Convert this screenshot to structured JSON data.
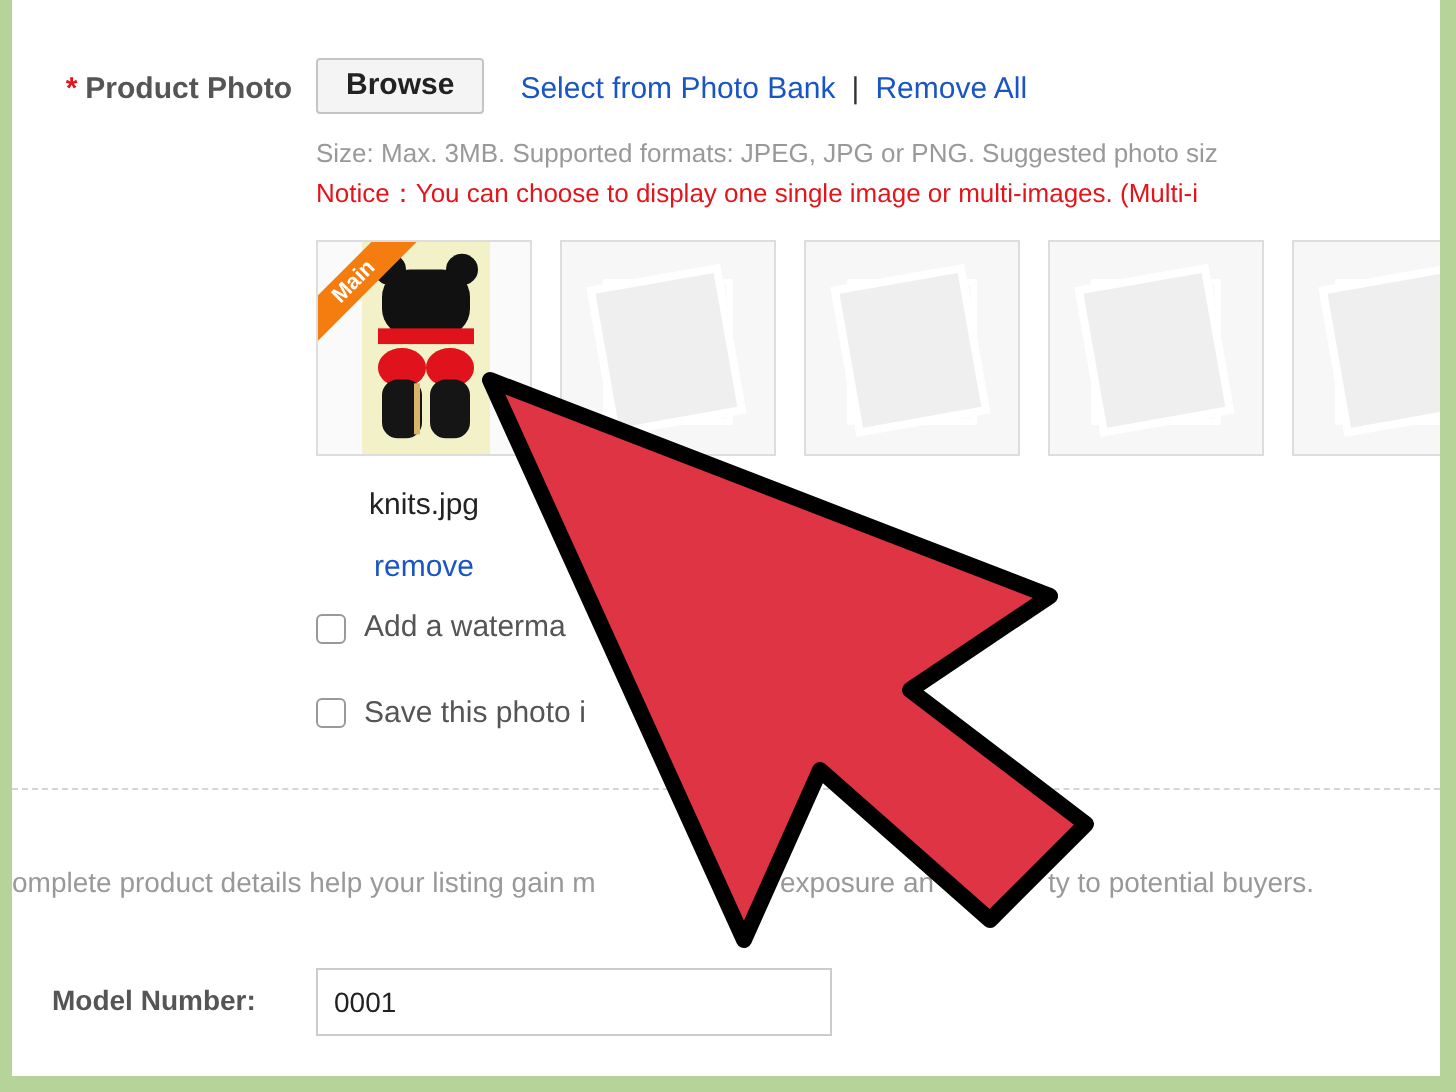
{
  "product_photo": {
    "required_mark": "*",
    "label": "Product Photo",
    "browse_button": "Browse",
    "links": [
      "Select from Photo Bank",
      "Remove All"
    ],
    "separator": "|"
  },
  "size_hint": "Size: Max. 3MB. Supported formats: JPEG, JPG or PNG. Suggested photo siz",
  "notice": "Notice：You can choose to display one single image or multi-images. (Multi-i",
  "photos": [
    {
      "badge": "Main",
      "filename": "knits.jpg",
      "action": "remove"
    },
    {
      "kind": "empty"
    },
    {
      "kind": "empty"
    },
    {
      "kind": "empty"
    },
    {
      "kind": "empty"
    }
  ],
  "options": [
    {
      "label": "Add a waterma",
      "checked": false
    },
    {
      "label": "Save this photo i",
      "checked": false
    }
  ],
  "info": [
    "omplete product details help your listing gain m",
    "exposure an",
    "ty to potential buyers."
  ],
  "model_number": {
    "label": "Model Number:",
    "value": "0001"
  }
}
